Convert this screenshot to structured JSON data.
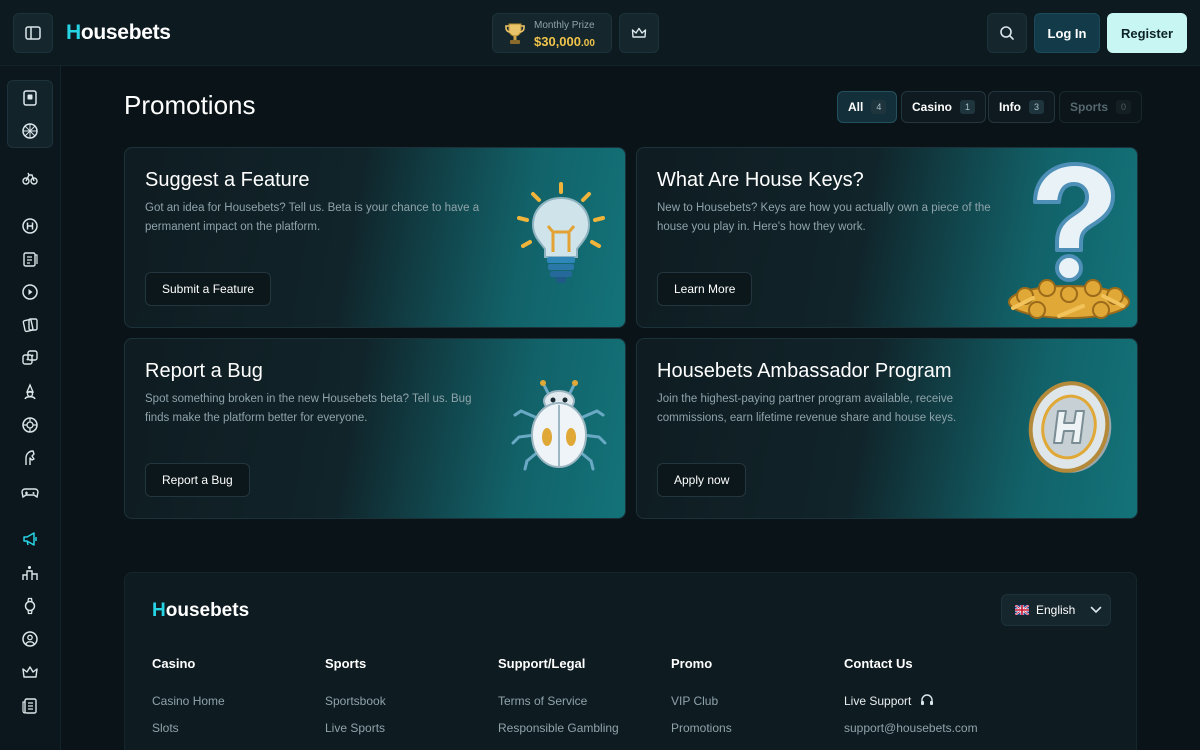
{
  "header": {
    "logo_first": "H",
    "logo_rest": "ousebets",
    "prize_label": "Monthly Prize",
    "prize_amount": "$30,000",
    "prize_cents": ".00",
    "login_label": "Log In",
    "register_label": "Register"
  },
  "sidebar": {
    "icons": [
      "casino-icon",
      "sports-ball-icon",
      "bike-icon",
      "house-coin-icon",
      "news-icon",
      "play-icon",
      "cards-icon",
      "dice-icon",
      "wizard-icon",
      "roulette-icon",
      "horse-icon",
      "gamepad-icon",
      "megaphone-icon",
      "podium-icon",
      "watch-icon",
      "support-user-icon",
      "crown-icon",
      "newspaper-icon"
    ]
  },
  "main": {
    "title": "Promotions",
    "filters": [
      {
        "label": "All",
        "count": "4"
      },
      {
        "label": "Casino",
        "count": "1"
      },
      {
        "label": "Info",
        "count": "3"
      },
      {
        "label": "Sports",
        "count": "0"
      }
    ],
    "cards": [
      {
        "title": "Suggest a Feature",
        "text": "Got an idea for Housebets? Tell us. Beta is your chance to have a permanent impact on the platform.",
        "cta": "Submit a Feature",
        "art": "lightbulb-icon"
      },
      {
        "title": "What Are House Keys?",
        "text": "New to Housebets? Keys are how you actually own a piece of the house you play in. Here's how they work.",
        "cta": "Learn More",
        "art": "question-keys-icon"
      },
      {
        "title": "Report a Bug",
        "text": "Spot something broken in the new Housebets beta? Tell us. Bug finds make the platform better for everyone.",
        "cta": "Report a Bug",
        "art": "bug-icon"
      },
      {
        "title": "Housebets Ambassador Program",
        "text": "Join the highest-paying partner program available, receive commissions, earn lifetime revenue share and house keys.",
        "cta": "Apply now",
        "art": "h-coin-icon"
      }
    ]
  },
  "footer": {
    "logo_first": "H",
    "logo_rest": "ousebets",
    "language": "English",
    "columns": [
      {
        "title": "Casino",
        "links": [
          "Casino Home",
          "Slots"
        ]
      },
      {
        "title": "Sports",
        "links": [
          "Sportsbook",
          "Live Sports"
        ]
      },
      {
        "title": "Support/Legal",
        "links": [
          "Terms of Service",
          "Responsible Gambling"
        ]
      },
      {
        "title": "Promo",
        "links": [
          "VIP Club",
          "Promotions"
        ]
      },
      {
        "title": "Contact Us",
        "links": [
          "Live Support",
          "support@housebets.com"
        ]
      }
    ]
  },
  "colors": {
    "accent": "#27d4e4",
    "prize_gold": "#f0c44a",
    "register_bg": "#c8f6f2",
    "background": "#0a1418"
  }
}
